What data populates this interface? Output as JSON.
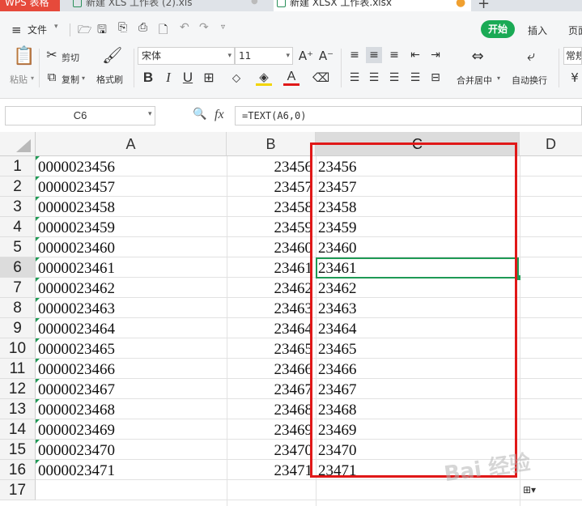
{
  "tabs": [
    {
      "label": "WPS 表格"
    },
    {
      "label": "新建 XLS 工作表 (2).xls"
    },
    {
      "label": "新建 XLSX 工作表.xlsx"
    }
  ],
  "menu": {
    "file": "文件",
    "start": "开始",
    "insert": "插入",
    "page": "页面"
  },
  "ribbon": {
    "paste": "粘贴",
    "cut": "剪切",
    "copy": "复制",
    "format_painter": "格式刷",
    "font": "宋体",
    "font_size": "11",
    "merge": "合并居中",
    "wrap": "自动换行",
    "number_format": "常规"
  },
  "formula_bar": {
    "name_box": "C6",
    "formula": "=TEXT(A6,0)"
  },
  "columns": [
    "A",
    "B",
    "C",
    "D"
  ],
  "rows": [
    {
      "n": "1",
      "a": "0000023456",
      "b": "23456",
      "c": "23456"
    },
    {
      "n": "2",
      "a": "0000023457",
      "b": "23457",
      "c": "23457"
    },
    {
      "n": "3",
      "a": "0000023458",
      "b": "23458",
      "c": "23458"
    },
    {
      "n": "4",
      "a": "0000023459",
      "b": "23459",
      "c": "23459"
    },
    {
      "n": "5",
      "a": "0000023460",
      "b": "23460",
      "c": "23460"
    },
    {
      "n": "6",
      "a": "0000023461",
      "b": "23461",
      "c": "23461"
    },
    {
      "n": "7",
      "a": "0000023462",
      "b": "23462",
      "c": "23462"
    },
    {
      "n": "8",
      "a": "0000023463",
      "b": "23463",
      "c": "23463"
    },
    {
      "n": "9",
      "a": "0000023464",
      "b": "23464",
      "c": "23464"
    },
    {
      "n": "10",
      "a": "0000023465",
      "b": "23465",
      "c": "23465"
    },
    {
      "n": "11",
      "a": "0000023466",
      "b": "23466",
      "c": "23466"
    },
    {
      "n": "12",
      "a": "0000023467",
      "b": "23467",
      "c": "23467"
    },
    {
      "n": "13",
      "a": "0000023468",
      "b": "23468",
      "c": "23468"
    },
    {
      "n": "14",
      "a": "0000023469",
      "b": "23469",
      "c": "23469"
    },
    {
      "n": "15",
      "a": "0000023470",
      "b": "23470",
      "c": "23470"
    },
    {
      "n": "16",
      "a": "0000023471",
      "b": "23471",
      "c": "23471"
    },
    {
      "n": "17",
      "a": "",
      "b": "",
      "c": ""
    }
  ],
  "watermark": "Bai 经验",
  "colors": {
    "accent": "#1aaa55",
    "highlight": "#e01818",
    "wps_red": "#e64a3b"
  }
}
